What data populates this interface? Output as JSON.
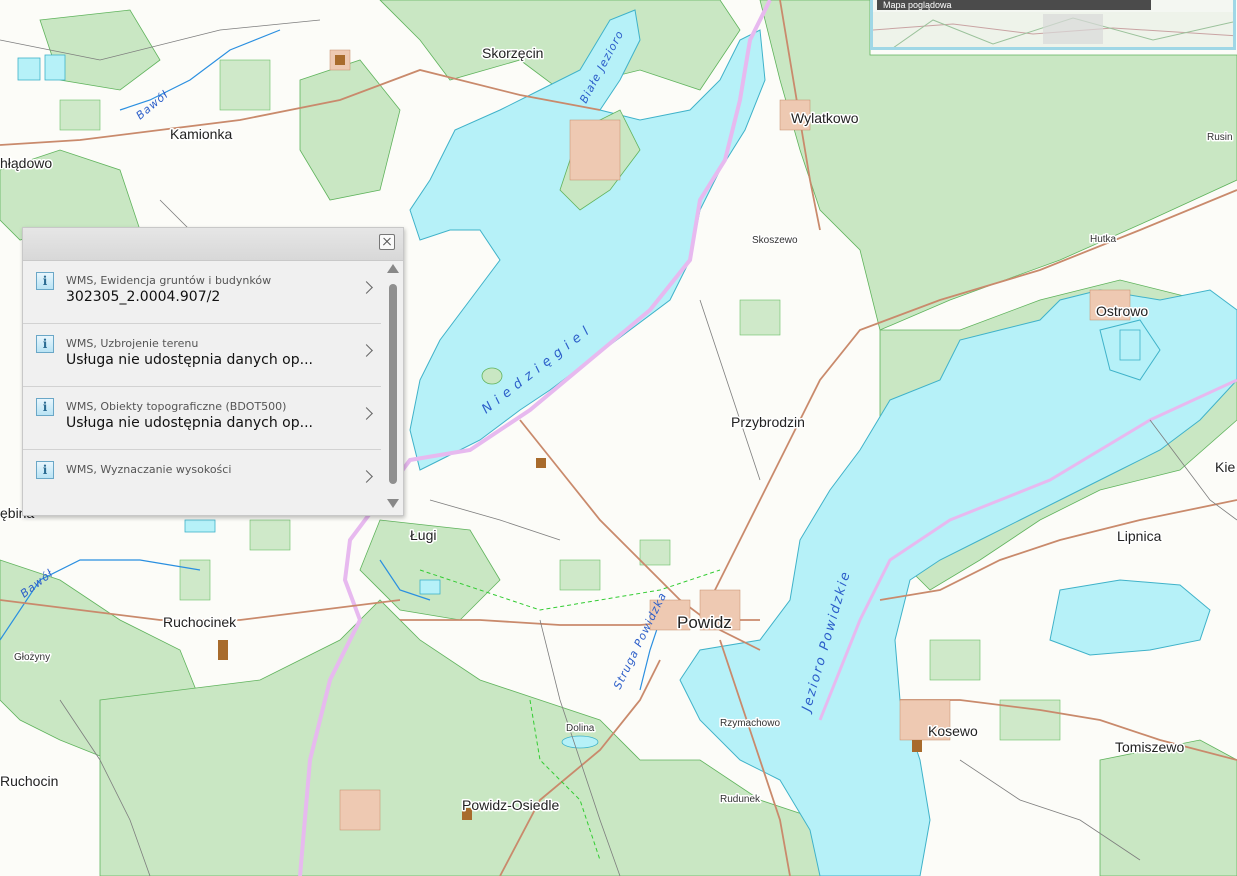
{
  "popup": {
    "close_label": "close",
    "items": [
      {
        "subtitle": "WMS, Ewidencja gruntów i budynków",
        "value": "302305_2.0004.907/2"
      },
      {
        "subtitle": "WMS, Uzbrojenie terenu",
        "value": "Usługa nie udostępnia danych op..."
      },
      {
        "subtitle": "WMS, Obiekty topograficzne (BDOT500)",
        "value": "Usługa nie udostępnia danych op..."
      },
      {
        "subtitle": "WMS, Wyznaczanie wysokości",
        "value": ""
      }
    ]
  },
  "map": {
    "places": {
      "skorzecin": "Skorzęcin",
      "kamionka": "Kamionka",
      "hladowo": "hłądowo",
      "wylatkowo": "Wylatkowo",
      "rusin": "Rusin",
      "hutka": "Hutka",
      "ostrowo": "Ostrowo",
      "skoszewo": "Skoszewo",
      "przybrodzin": "Przybrodzin",
      "kie": "Kie",
      "lipnica": "Lipnica",
      "lugi": "Ługi",
      "debina": "ębina",
      "ruchocinek": "Ruchocinek",
      "glozyny": "Głożyny",
      "powidz": "Powidz",
      "rzymachowo": "Rzymachowo",
      "kosewo": "Kosewo",
      "tomiszewo": "Tomiszewo",
      "ruchocin": "Ruchocin",
      "dolina": "Dolina",
      "powidz_osiedle": "Powidz-Osiedle",
      "rudunek": "Rudunek"
    },
    "water": {
      "biale_jezioro": "Białe Jezioro",
      "niedzieg": "Niedzięgiel",
      "jezioro_powidzkie": "Jezioro Powidzkie",
      "bawol1": "Bawół",
      "bawol2": "Bawół",
      "struga": "Struga Powidzka"
    }
  },
  "overview": {
    "caption": "Mapa poglądowa"
  },
  "colors": {
    "water": "#b6f1f8",
    "forest": "#c8e6c2",
    "road": "#c98a6c",
    "border": "#e7b9ef",
    "panel": "#f0f0f0"
  }
}
